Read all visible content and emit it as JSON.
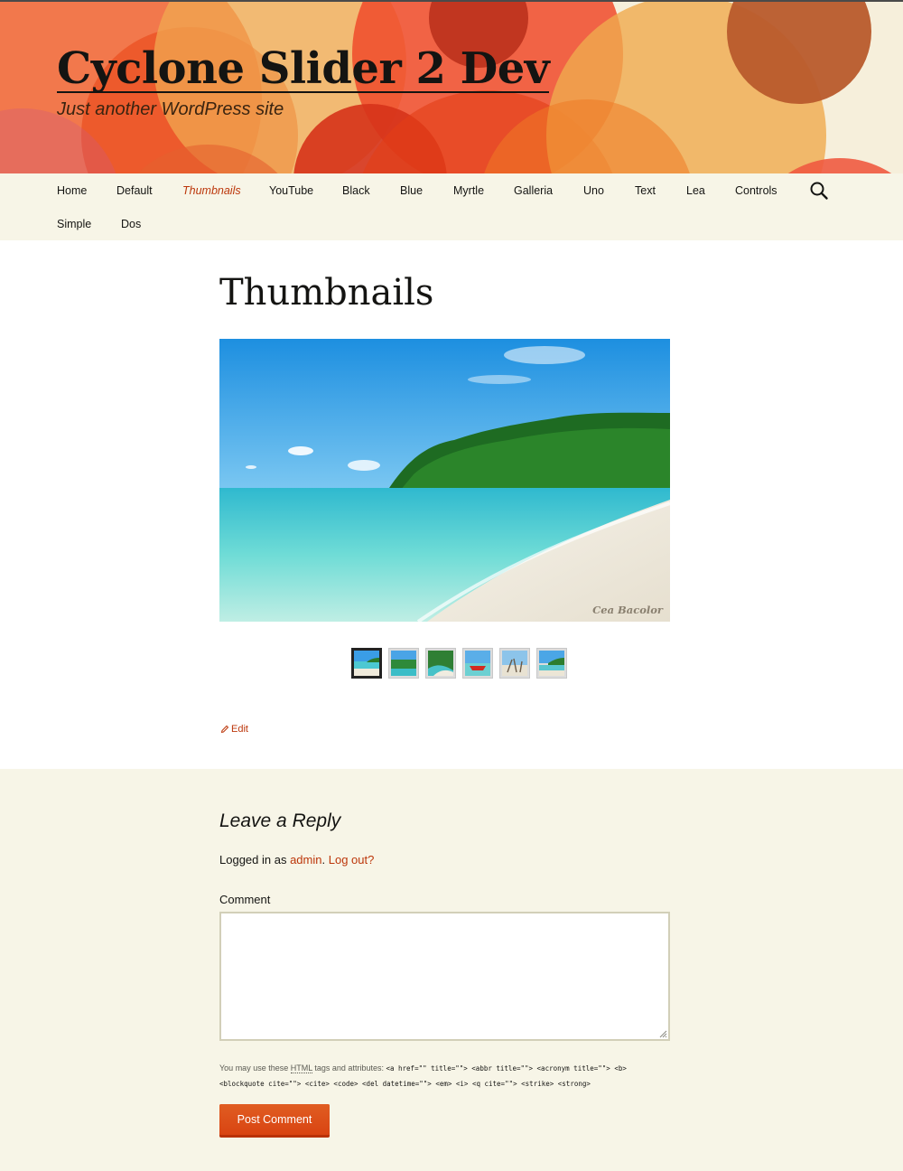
{
  "site": {
    "title": "Cyclone Slider 2 Dev",
    "tagline": "Just another WordPress site"
  },
  "colors": {
    "accent": "#bc360a",
    "button": "#e05d22",
    "header_bg": "#f6efdb",
    "nav_bg": "#f7f5e7",
    "comments_bg": "#f7f5e7"
  },
  "nav": {
    "items": [
      {
        "label": "Home"
      },
      {
        "label": "Default"
      },
      {
        "label": "Thumbnails",
        "current": true
      },
      {
        "label": "YouTube"
      },
      {
        "label": "Black"
      },
      {
        "label": "Blue"
      },
      {
        "label": "Myrtle"
      },
      {
        "label": "Galleria"
      },
      {
        "label": "Uno"
      },
      {
        "label": "Text"
      },
      {
        "label": "Lea"
      },
      {
        "label": "Controls"
      },
      {
        "label": "Simple"
      },
      {
        "label": "Dos"
      }
    ],
    "search_icon": "search-icon"
  },
  "page": {
    "title": "Thumbnails",
    "slide_credit": "Cea Bacolor",
    "thumbnail_count": 6,
    "active_thumbnail": 1,
    "edit_label": "Edit"
  },
  "comments": {
    "reply_title": "Leave a Reply",
    "logged_in_prefix": "Logged in as ",
    "user": "admin",
    "separator": ".",
    "logout_label": "Log out?",
    "comment_label": "Comment",
    "tags_prefix": "You may use these ",
    "tags_abbr": "HTML",
    "tags_suffix": " tags and attributes: ",
    "tags_code": "<a href=\"\" title=\"\"> <abbr title=\"\"> <acronym title=\"\"> <b> <blockquote cite=\"\"> <cite> <code> <del datetime=\"\"> <em> <i> <q cite=\"\"> <strike> <strong>",
    "submit_label": "Post Comment"
  }
}
